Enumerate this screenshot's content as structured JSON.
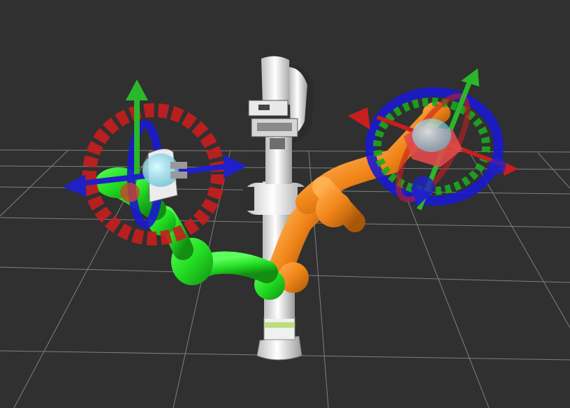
{
  "scene": {
    "description_visible_text": [],
    "colors": {
      "background": "#303030",
      "grid_line": "#9a9a9a",
      "robot_base": "#f2f2f2",
      "robot_dark": "#3a3a3a",
      "arm_left": "#2ee62e",
      "arm_right": "#f28a1e",
      "ring_red": "#d51e1e",
      "ring_blue": "#1a1ad0",
      "ring_green": "#1ea81e",
      "arrow_green": "#2ab82a",
      "arrow_blue": "#2020c8",
      "arrow_red": "#c81e1e",
      "gripper_ghost": "#8fe3f0"
    }
  }
}
